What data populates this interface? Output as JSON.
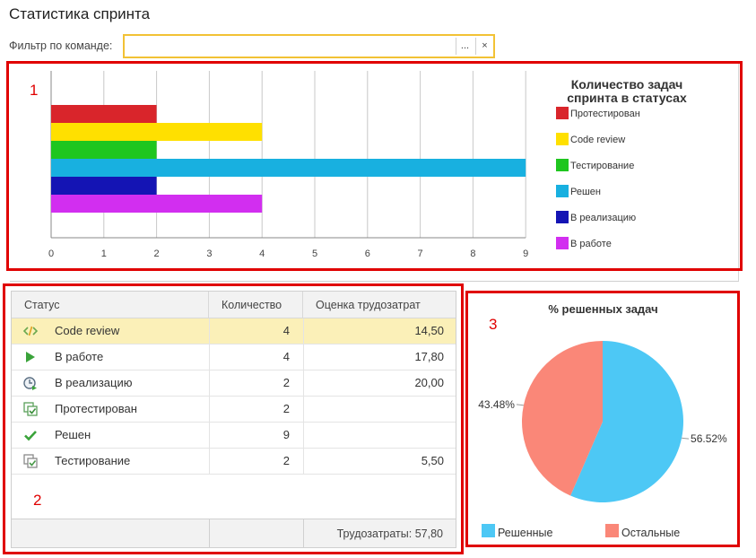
{
  "page": {
    "title": "Статистика спринта",
    "filter_label": "Фильтр по команде:",
    "filter_value": "",
    "choose_button": "...",
    "clear_button": "×"
  },
  "annotations": [
    "1",
    "2",
    "3"
  ],
  "chart_data": [
    {
      "type": "bar",
      "orientation": "horizontal",
      "title": "Количество задач спринта в статусах",
      "xlim": [
        0,
        9
      ],
      "xticks": [
        "0",
        "1",
        "2",
        "3",
        "4",
        "5",
        "6",
        "7",
        "8",
        "9"
      ],
      "grid": true,
      "legend_position": "right",
      "series": [
        {
          "name": "Протестирован",
          "value": 2,
          "color": "#d9252b"
        },
        {
          "name": "Code review",
          "value": 4,
          "color": "#ffe000"
        },
        {
          "name": "Тестирование",
          "value": 2,
          "color": "#1fc61f"
        },
        {
          "name": "Решен",
          "value": 9,
          "color": "#18b0e0"
        },
        {
          "name": "В реализацию",
          "value": 2,
          "color": "#1414b4"
        },
        {
          "name": "В работе",
          "value": 4,
          "color": "#d22ef0"
        }
      ]
    },
    {
      "type": "pie",
      "title": "% решенных задач",
      "legend_position": "bottom",
      "slices": [
        {
          "name": "Решенные",
          "value": 56.52,
          "label": "56.52%",
          "color": "#4dc8f5"
        },
        {
          "name": "Остальные",
          "value": 43.48,
          "label": "43.48%",
          "color": "#fa8778"
        }
      ]
    }
  ],
  "table": {
    "columns": [
      "Статус",
      "Количество",
      "Оценка трудозатрат"
    ],
    "rows": [
      {
        "icon": "code-review-icon",
        "status": "Code review",
        "count": "4",
        "effort": "14,50",
        "selected": true
      },
      {
        "icon": "play-icon",
        "status": "В работе",
        "count": "4",
        "effort": "17,80",
        "selected": false
      },
      {
        "icon": "in-progress-clock-icon",
        "status": "В реализацию",
        "count": "2",
        "effort": "20,00",
        "selected": false
      },
      {
        "icon": "tested-icon",
        "status": "Протестирован",
        "count": "2",
        "effort": "",
        "selected": false
      },
      {
        "icon": "checkmark-icon",
        "status": "Решен",
        "count": "9",
        "effort": "",
        "selected": false
      },
      {
        "icon": "testing-icon",
        "status": "Тестирование",
        "count": "2",
        "effort": "5,50",
        "selected": false
      }
    ],
    "footer_total": "Трудозатраты: 57,80"
  },
  "colors": {
    "annotation_red": "#e00000",
    "filter_border": "#f2c235",
    "selected_row": "#fbf0b8"
  }
}
